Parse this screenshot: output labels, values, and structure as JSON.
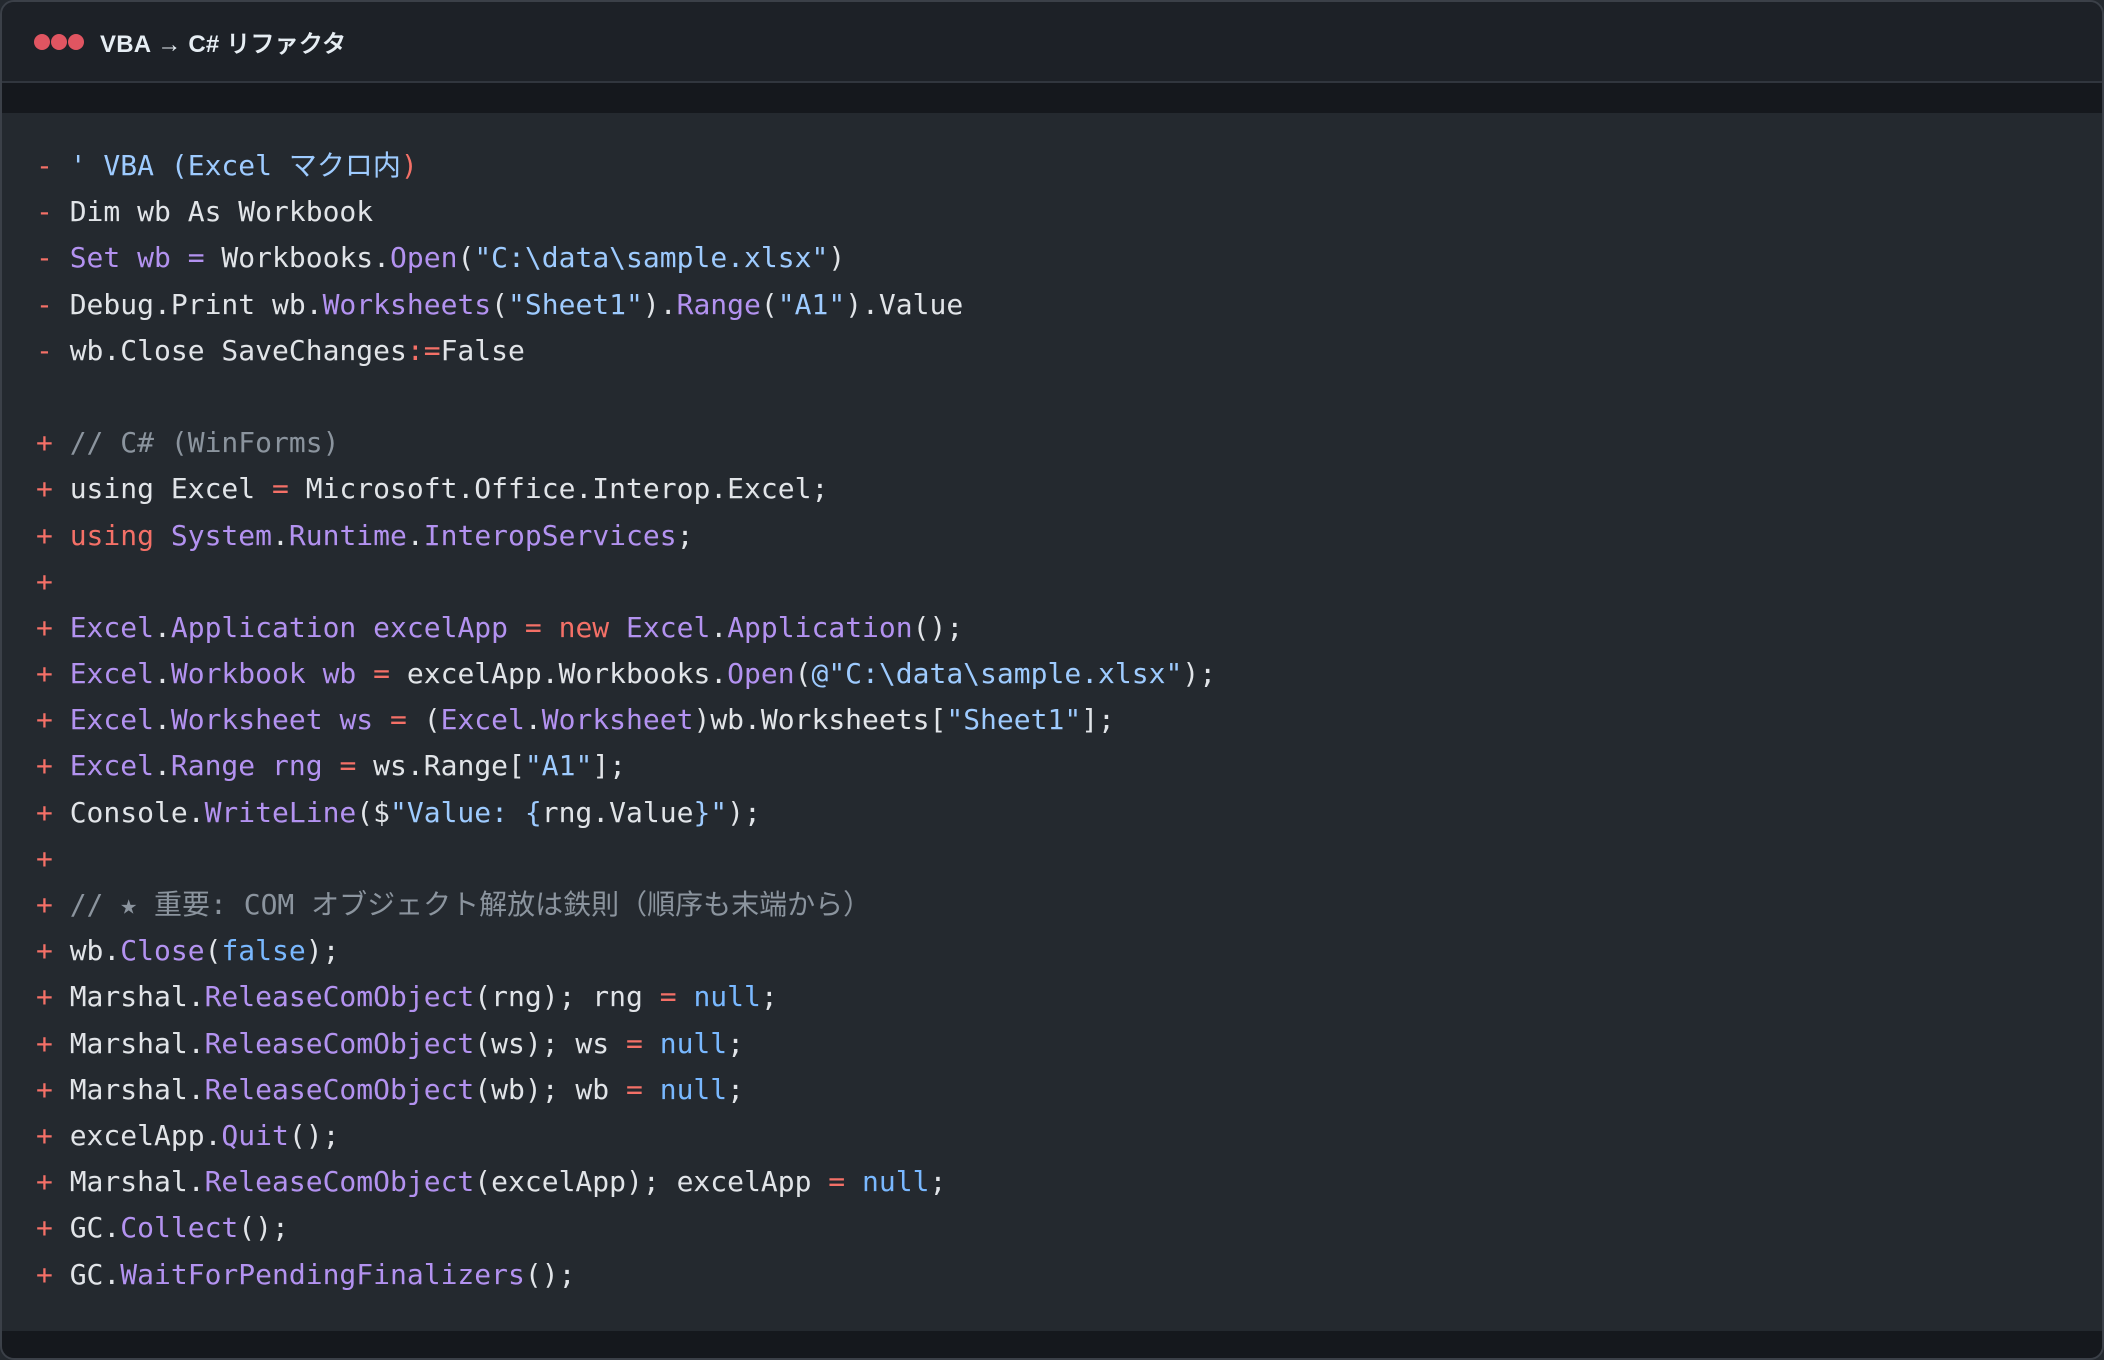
{
  "window": {
    "title": "VBA → C# リファクタ",
    "dot_color": "#e05561"
  },
  "syntax_colors": {
    "marker": "#f47067",
    "plain": "#e1e4e8",
    "kw": "#b392f0",
    "op": "#f47067",
    "str": "#9ecbff",
    "com": "#8b949e",
    "lit": "#79b8ff"
  },
  "code": {
    "lines": [
      {
        "marker": "-",
        "tokens": [
          {
            "t": "' VBA (Excel マクロ内",
            "k": "str"
          },
          {
            "t": ")",
            "k": "op"
          }
        ]
      },
      {
        "marker": "-",
        "tokens": [
          {
            "t": "Dim wb As Workbook",
            "k": "plain"
          }
        ]
      },
      {
        "marker": "-",
        "tokens": [
          {
            "t": "Set wb",
            "k": "kw"
          },
          {
            "t": " ",
            "k": "plain"
          },
          {
            "t": "=",
            "k": "kw"
          },
          {
            "t": " Workbooks.",
            "k": "plain"
          },
          {
            "t": "Open",
            "k": "kw"
          },
          {
            "t": "(",
            "k": "plain"
          },
          {
            "t": "\"C:\\data\\sample.xlsx\"",
            "k": "str"
          },
          {
            "t": ")",
            "k": "plain"
          }
        ]
      },
      {
        "marker": "-",
        "tokens": [
          {
            "t": "Debug.Print wb.",
            "k": "plain"
          },
          {
            "t": "Worksheets",
            "k": "kw"
          },
          {
            "t": "(",
            "k": "plain"
          },
          {
            "t": "\"Sheet1\"",
            "k": "str"
          },
          {
            "t": ").",
            "k": "plain"
          },
          {
            "t": "Range",
            "k": "kw"
          },
          {
            "t": "(",
            "k": "plain"
          },
          {
            "t": "\"A1\"",
            "k": "str"
          },
          {
            "t": ").Value",
            "k": "plain"
          }
        ]
      },
      {
        "marker": "-",
        "tokens": [
          {
            "t": "wb.Close SaveChanges",
            "k": "plain"
          },
          {
            "t": ":=",
            "k": "op"
          },
          {
            "t": "False",
            "k": "plain"
          }
        ]
      },
      {
        "marker": "",
        "tokens": []
      },
      {
        "marker": "+",
        "tokens": [
          {
            "t": "// C# (WinForms)",
            "k": "com"
          }
        ]
      },
      {
        "marker": "+",
        "tokens": [
          {
            "t": "using Excel ",
            "k": "plain"
          },
          {
            "t": "=",
            "k": "op"
          },
          {
            "t": " Microsoft.Office.Interop.Excel;",
            "k": "plain"
          }
        ]
      },
      {
        "marker": "+",
        "tokens": [
          {
            "t": "using",
            "k": "op"
          },
          {
            "t": " ",
            "k": "plain"
          },
          {
            "t": "System",
            "k": "kw"
          },
          {
            "t": ".",
            "k": "plain"
          },
          {
            "t": "Runtime",
            "k": "kw"
          },
          {
            "t": ".",
            "k": "plain"
          },
          {
            "t": "InteropServices",
            "k": "kw"
          },
          {
            "t": ";",
            "k": "plain"
          }
        ]
      },
      {
        "marker": "+",
        "tokens": []
      },
      {
        "marker": "+",
        "tokens": [
          {
            "t": "Excel",
            "k": "kw"
          },
          {
            "t": ".",
            "k": "plain"
          },
          {
            "t": "Application",
            "k": "kw"
          },
          {
            "t": " ",
            "k": "plain"
          },
          {
            "t": "excelApp",
            "k": "kw"
          },
          {
            "t": " ",
            "k": "plain"
          },
          {
            "t": "=",
            "k": "op"
          },
          {
            "t": " ",
            "k": "plain"
          },
          {
            "t": "new",
            "k": "op"
          },
          {
            "t": " ",
            "k": "plain"
          },
          {
            "t": "Excel",
            "k": "kw"
          },
          {
            "t": ".",
            "k": "plain"
          },
          {
            "t": "Application",
            "k": "kw"
          },
          {
            "t": "();",
            "k": "plain"
          }
        ]
      },
      {
        "marker": "+",
        "tokens": [
          {
            "t": "Excel",
            "k": "kw"
          },
          {
            "t": ".",
            "k": "plain"
          },
          {
            "t": "Workbook",
            "k": "kw"
          },
          {
            "t": " ",
            "k": "plain"
          },
          {
            "t": "wb",
            "k": "kw"
          },
          {
            "t": " ",
            "k": "plain"
          },
          {
            "t": "=",
            "k": "op"
          },
          {
            "t": " excelApp.Workbooks.",
            "k": "plain"
          },
          {
            "t": "Open",
            "k": "kw"
          },
          {
            "t": "(",
            "k": "plain"
          },
          {
            "t": "@\"C:\\data\\sample.xlsx\"",
            "k": "str"
          },
          {
            "t": ");",
            "k": "plain"
          }
        ]
      },
      {
        "marker": "+",
        "tokens": [
          {
            "t": "Excel",
            "k": "kw"
          },
          {
            "t": ".",
            "k": "plain"
          },
          {
            "t": "Worksheet",
            "k": "kw"
          },
          {
            "t": " ",
            "k": "plain"
          },
          {
            "t": "ws",
            "k": "kw"
          },
          {
            "t": " ",
            "k": "plain"
          },
          {
            "t": "=",
            "k": "op"
          },
          {
            "t": " (",
            "k": "plain"
          },
          {
            "t": "Excel",
            "k": "kw"
          },
          {
            "t": ".",
            "k": "plain"
          },
          {
            "t": "Worksheet",
            "k": "kw"
          },
          {
            "t": ")wb.Worksheets[",
            "k": "plain"
          },
          {
            "t": "\"Sheet1\"",
            "k": "str"
          },
          {
            "t": "];",
            "k": "plain"
          }
        ]
      },
      {
        "marker": "+",
        "tokens": [
          {
            "t": "Excel",
            "k": "kw"
          },
          {
            "t": ".",
            "k": "plain"
          },
          {
            "t": "Range",
            "k": "kw"
          },
          {
            "t": " ",
            "k": "plain"
          },
          {
            "t": "rng",
            "k": "kw"
          },
          {
            "t": " ",
            "k": "plain"
          },
          {
            "t": "=",
            "k": "op"
          },
          {
            "t": " ws.Range[",
            "k": "plain"
          },
          {
            "t": "\"A1\"",
            "k": "str"
          },
          {
            "t": "];",
            "k": "plain"
          }
        ]
      },
      {
        "marker": "+",
        "tokens": [
          {
            "t": "Console.",
            "k": "plain"
          },
          {
            "t": "WriteLine",
            "k": "kw"
          },
          {
            "t": "(",
            "k": "plain"
          },
          {
            "t": "$",
            "k": "plain"
          },
          {
            "t": "\"Value: {",
            "k": "str"
          },
          {
            "t": "rng.Value",
            "k": "plain"
          },
          {
            "t": "}\"",
            "k": "str"
          },
          {
            "t": ");",
            "k": "plain"
          }
        ]
      },
      {
        "marker": "+",
        "tokens": []
      },
      {
        "marker": "+",
        "tokens": [
          {
            "t": "// ★ 重要: COM オブジェクト解放は鉄則（順序も末端から）",
            "k": "com"
          }
        ]
      },
      {
        "marker": "+",
        "tokens": [
          {
            "t": "wb.",
            "k": "plain"
          },
          {
            "t": "Close",
            "k": "kw"
          },
          {
            "t": "(",
            "k": "plain"
          },
          {
            "t": "false",
            "k": "lit"
          },
          {
            "t": ");",
            "k": "plain"
          }
        ]
      },
      {
        "marker": "+",
        "tokens": [
          {
            "t": "Marshal.",
            "k": "plain"
          },
          {
            "t": "ReleaseComObject",
            "k": "kw"
          },
          {
            "t": "(rng); rng ",
            "k": "plain"
          },
          {
            "t": "=",
            "k": "op"
          },
          {
            "t": " ",
            "k": "plain"
          },
          {
            "t": "null",
            "k": "lit"
          },
          {
            "t": ";",
            "k": "plain"
          }
        ]
      },
      {
        "marker": "+",
        "tokens": [
          {
            "t": "Marshal.",
            "k": "plain"
          },
          {
            "t": "ReleaseComObject",
            "k": "kw"
          },
          {
            "t": "(ws); ws ",
            "k": "plain"
          },
          {
            "t": "=",
            "k": "op"
          },
          {
            "t": " ",
            "k": "plain"
          },
          {
            "t": "null",
            "k": "lit"
          },
          {
            "t": ";",
            "k": "plain"
          }
        ]
      },
      {
        "marker": "+",
        "tokens": [
          {
            "t": "Marshal.",
            "k": "plain"
          },
          {
            "t": "ReleaseComObject",
            "k": "kw"
          },
          {
            "t": "(wb); wb ",
            "k": "plain"
          },
          {
            "t": "=",
            "k": "op"
          },
          {
            "t": " ",
            "k": "plain"
          },
          {
            "t": "null",
            "k": "lit"
          },
          {
            "t": ";",
            "k": "plain"
          }
        ]
      },
      {
        "marker": "+",
        "tokens": [
          {
            "t": "excelApp.",
            "k": "plain"
          },
          {
            "t": "Quit",
            "k": "kw"
          },
          {
            "t": "();",
            "k": "plain"
          }
        ]
      },
      {
        "marker": "+",
        "tokens": [
          {
            "t": "Marshal.",
            "k": "plain"
          },
          {
            "t": "ReleaseComObject",
            "k": "kw"
          },
          {
            "t": "(excelApp); excelApp ",
            "k": "plain"
          },
          {
            "t": "=",
            "k": "op"
          },
          {
            "t": " ",
            "k": "plain"
          },
          {
            "t": "null",
            "k": "lit"
          },
          {
            "t": ";",
            "k": "plain"
          }
        ]
      },
      {
        "marker": "+",
        "tokens": [
          {
            "t": "GC.",
            "k": "plain"
          },
          {
            "t": "Collect",
            "k": "kw"
          },
          {
            "t": "();",
            "k": "plain"
          }
        ]
      },
      {
        "marker": "+",
        "tokens": [
          {
            "t": "GC.",
            "k": "plain"
          },
          {
            "t": "WaitForPendingFinalizers",
            "k": "kw"
          },
          {
            "t": "();",
            "k": "plain"
          }
        ]
      }
    ]
  }
}
